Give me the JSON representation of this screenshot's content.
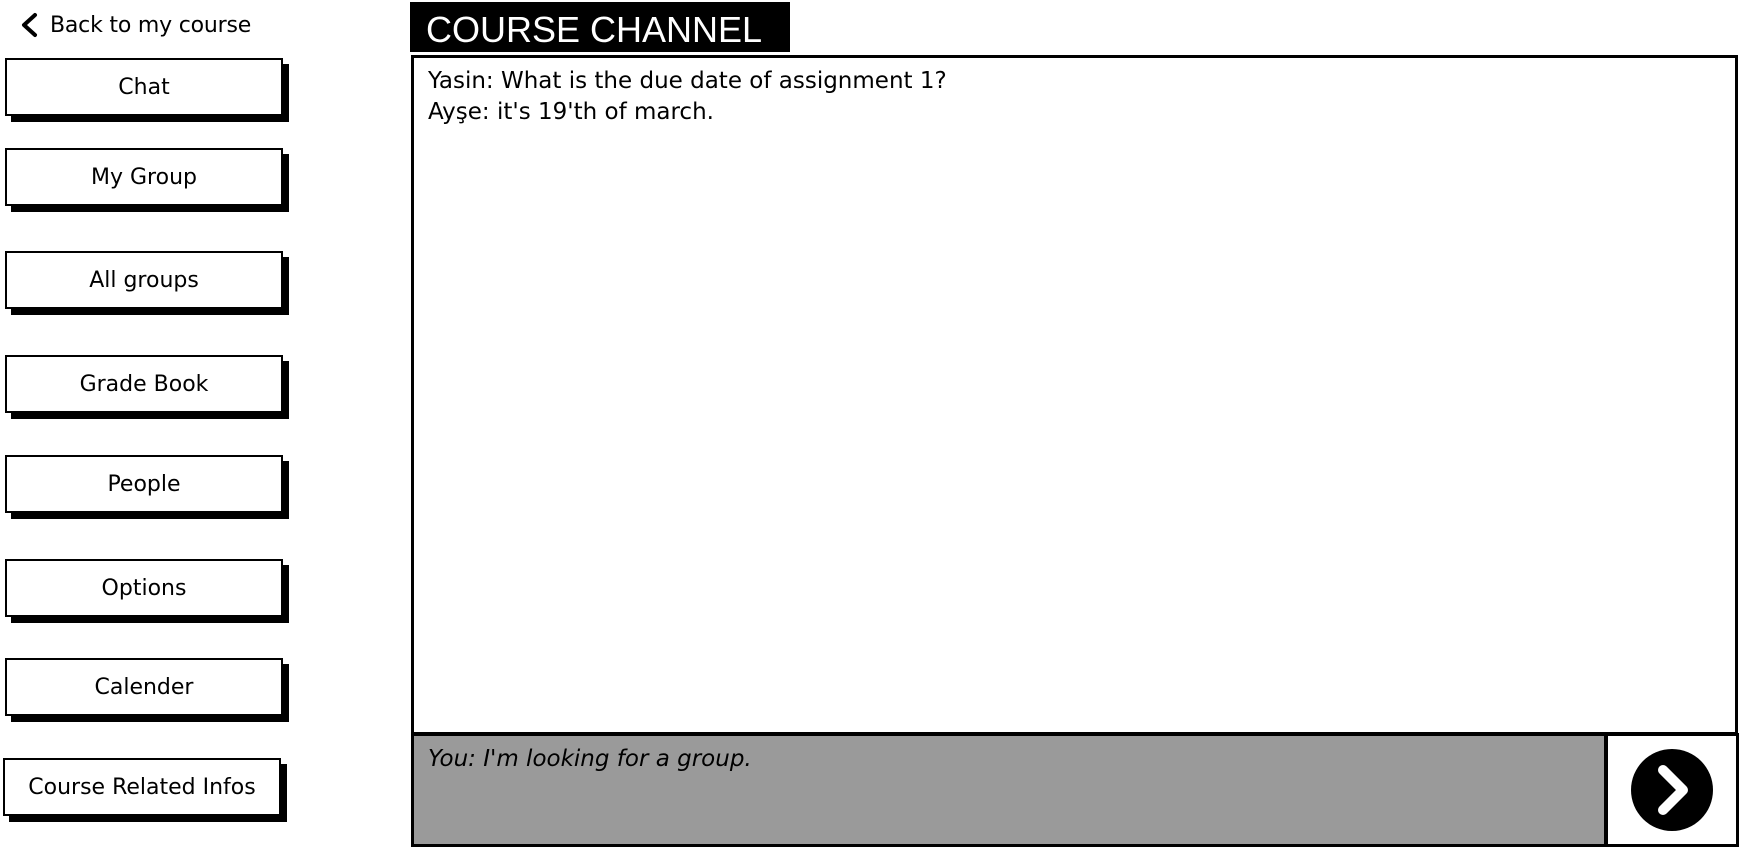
{
  "back_link": {
    "label": "Back to my course",
    "icon": "chevron-left-icon"
  },
  "sidebar": {
    "items": [
      {
        "label": "Chat"
      },
      {
        "label": "My Group"
      },
      {
        "label": "All groups"
      },
      {
        "label": "Grade Book"
      },
      {
        "label": "People"
      },
      {
        "label": "Options"
      },
      {
        "label": "Calender"
      },
      {
        "label": "Course Related Infos"
      }
    ]
  },
  "channel": {
    "title": "COURSE CHANNEL",
    "messages": [
      {
        "text": "Yasin: What is the due date of assignment 1?"
      },
      {
        "text": "Ayşe: it's 19'th of march."
      }
    ]
  },
  "composer": {
    "value": "You: I'm looking for a group.",
    "send_icon": "arrow-right-circle-icon"
  },
  "colors": {
    "header_bg": "#000000",
    "composer_bg": "#9a9a9a",
    "background": "#ffffff"
  }
}
